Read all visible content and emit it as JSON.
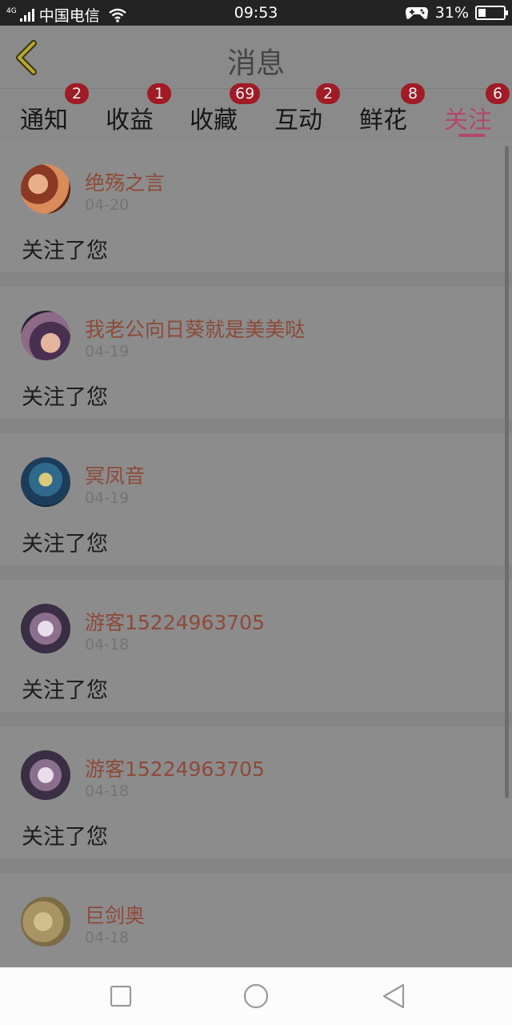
{
  "status": {
    "carrier": "中国电信",
    "network": "4G",
    "time": "09:53",
    "battery": "31%",
    "battery_level": 0.31
  },
  "header": {
    "title": "消息"
  },
  "tabs": [
    {
      "label": "通知",
      "badge": "2"
    },
    {
      "label": "收益",
      "badge": "1"
    },
    {
      "label": "收藏",
      "badge": "69"
    },
    {
      "label": "互动",
      "badge": "2"
    },
    {
      "label": "鲜花",
      "badge": "8"
    },
    {
      "label": "关注",
      "badge": "6"
    }
  ],
  "active_tab": "关注",
  "items": [
    {
      "name": "绝殇之言",
      "date": "04-20",
      "message": "关注了您"
    },
    {
      "name": "我老公向日葵就是美美哒",
      "date": "04-19",
      "message": "关注了您"
    },
    {
      "name": "冥凤音",
      "date": "04-19",
      "message": "关注了您"
    },
    {
      "name": "游客15224963705",
      "date": "04-18",
      "message": "关注了您"
    },
    {
      "name": "游客15224963705",
      "date": "04-18",
      "message": "关注了您"
    },
    {
      "name": "巨剑奥",
      "date": "04-18",
      "message": ""
    }
  ],
  "colors": {
    "accent": "#b5466e",
    "badge": "#a01b26",
    "name": "#8d4a38"
  },
  "icons": {
    "back": "chevron-left-icon",
    "wifi": "wifi-icon",
    "game": "gamepad-icon",
    "nav_recent": "square-icon",
    "nav_home": "circle-icon",
    "nav_back": "triangle-left-icon"
  }
}
